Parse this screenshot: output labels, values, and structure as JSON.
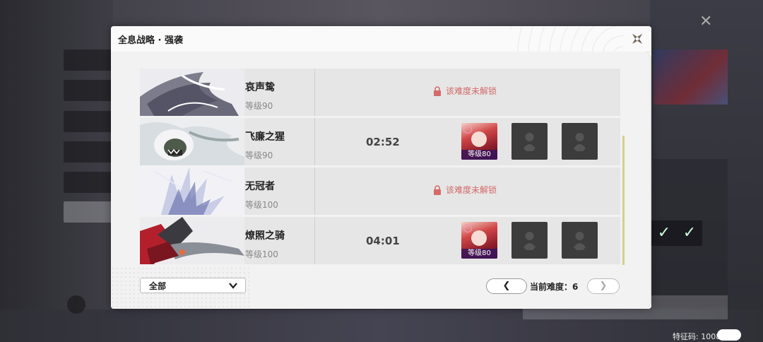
{
  "dialog": {
    "title": "全息战略 · 强袭"
  },
  "rows": [
    {
      "name": "哀声鸷",
      "level": "等级90",
      "status": "locked",
      "locked_text": "该难度未解锁"
    },
    {
      "name": "飞廉之猩",
      "level": "等级90",
      "status": "cleared",
      "time": "02:52",
      "team": [
        {
          "filled": true,
          "level": "等级80"
        },
        {
          "filled": false
        },
        {
          "filled": false
        }
      ]
    },
    {
      "name": "无冠者",
      "level": "等级100",
      "status": "locked",
      "locked_text": "该难度未解锁"
    },
    {
      "name": "燎照之骑",
      "level": "等级100",
      "status": "cleared",
      "time": "04:01",
      "team": [
        {
          "filled": true,
          "level": "等级80"
        },
        {
          "filled": false
        },
        {
          "filled": false
        }
      ]
    }
  ],
  "filter": {
    "selected": "全部"
  },
  "difficulty": {
    "prev_icon": "❮",
    "next_icon": "❯",
    "label": "当前难度：",
    "value": "6"
  },
  "device": {
    "id_label": "特征码: 10084"
  },
  "icons": {
    "lock": "lock-icon",
    "close": "close-icon",
    "chevron": "chevron-down-icon"
  },
  "colors": {
    "locked_text": "#d46a6a",
    "scrollbar": "#d6cf8a",
    "slot_level_bg": "#3c145a"
  }
}
